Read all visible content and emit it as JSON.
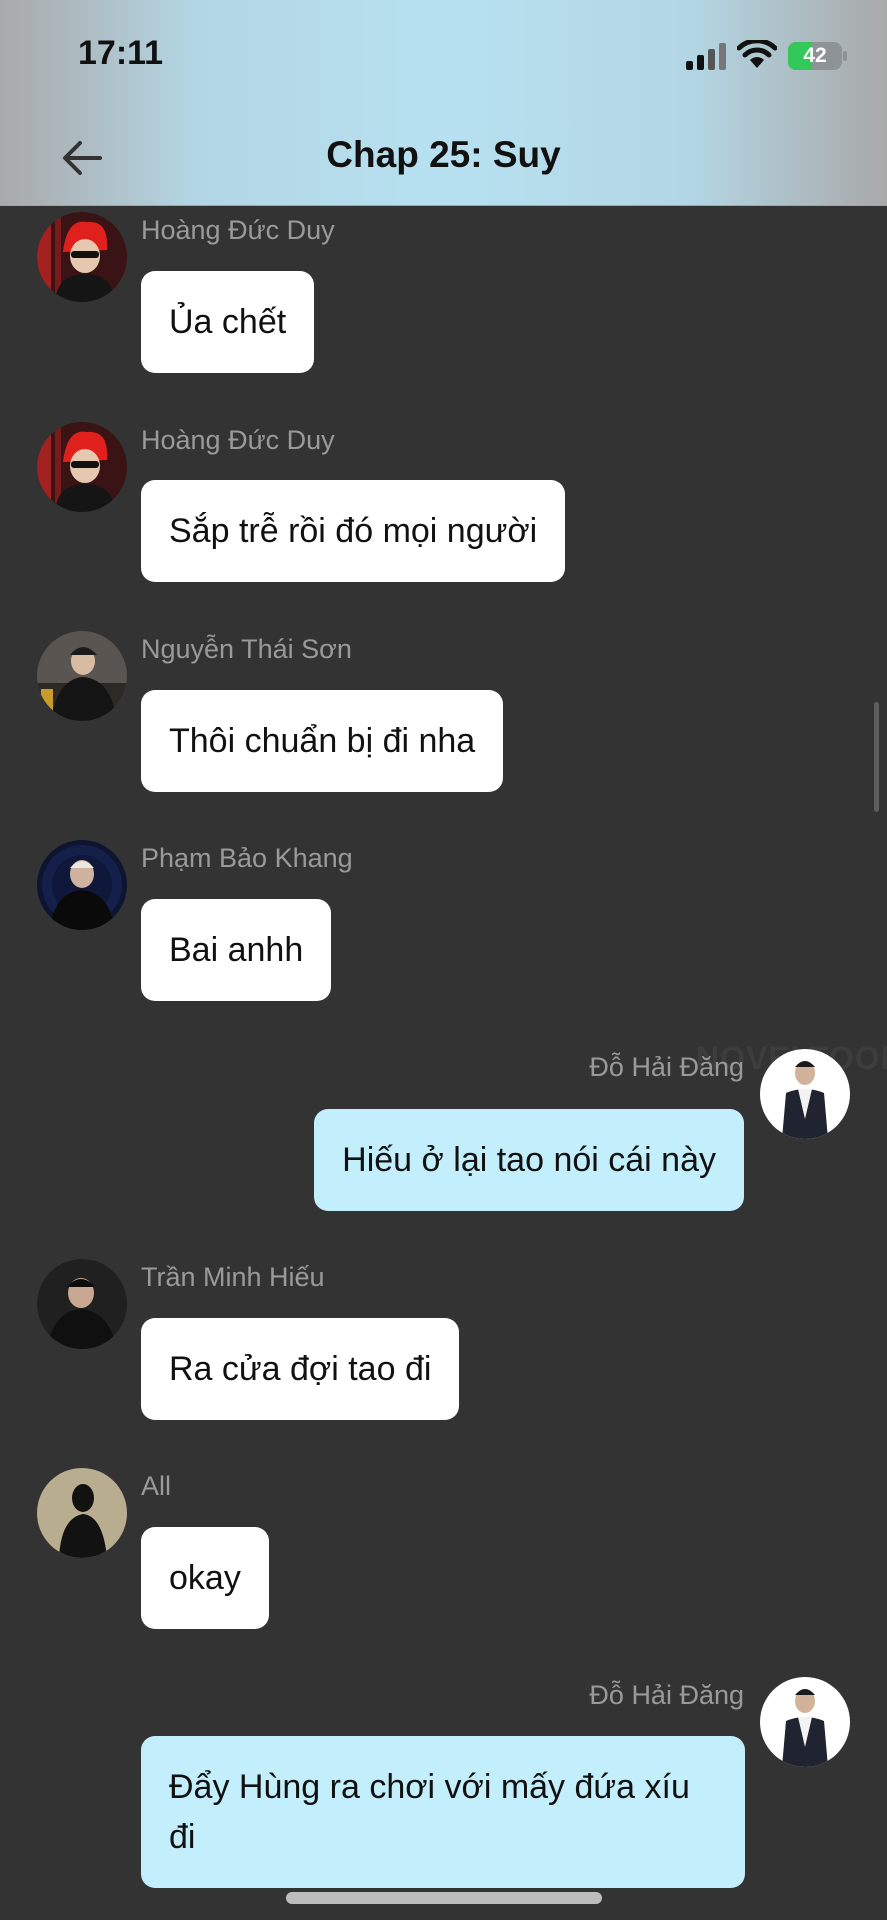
{
  "status_bar": {
    "time": "17:11",
    "battery": "42"
  },
  "header": {
    "title": "Chap 25: Suy"
  },
  "watermark": "NOVELTOON",
  "messages": [
    {
      "sender": "Hoàng Đức Duy",
      "text": "Ủa chết",
      "mine": false
    },
    {
      "sender": "Hoàng Đức Duy",
      "text": "Sắp trễ rồi đó mọi người",
      "mine": false
    },
    {
      "sender": "Nguyễn Thái Sơn",
      "text": "Thôi chuẩn bị đi nha",
      "mine": false
    },
    {
      "sender": "Phạm Bảo Khang",
      "text": "Bai anhh",
      "mine": false
    },
    {
      "sender": "Đỗ Hải Đăng",
      "text": "Hiếu ở lại tao nói cái này",
      "mine": true
    },
    {
      "sender": "Trần Minh Hiếu",
      "text": "Ra cửa đợi tao đi",
      "mine": false
    },
    {
      "sender": "All",
      "text": "okay",
      "mine": false
    },
    {
      "sender": "Đỗ Hải Đăng",
      "text": "Đẩy Hùng ra chơi với mấy đứa xíu đi",
      "mine": true
    }
  ],
  "colors": {
    "page_bg": "#333333",
    "bubble_other": "#ffffff",
    "bubble_mine": "#c3eefb",
    "sender_text": "#9a9a9a"
  }
}
